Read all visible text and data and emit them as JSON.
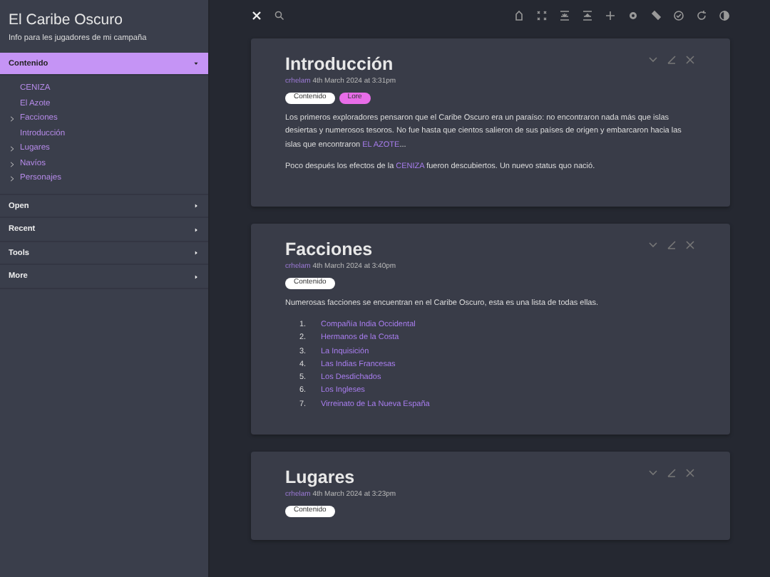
{
  "sidebar": {
    "title": "El Caribe Oscuro",
    "subtitle": "Info para les jugadores de mi campaña",
    "sections": [
      {
        "label": "Contenido",
        "expanded": true,
        "items": [
          {
            "label": "CENIZA",
            "kind": "leaf"
          },
          {
            "label": "El Azote",
            "kind": "leaf"
          },
          {
            "label": "Facciones",
            "kind": "folder"
          },
          {
            "label": "Introducción",
            "kind": "leaf"
          },
          {
            "label": "Lugares",
            "kind": "folder"
          },
          {
            "label": "Navíos",
            "kind": "folder"
          },
          {
            "label": "Personajes",
            "kind": "folder"
          }
        ]
      },
      {
        "label": "Open",
        "expanded": false
      },
      {
        "label": "Recent",
        "expanded": false
      },
      {
        "label": "Tools",
        "expanded": false
      },
      {
        "label": "More",
        "expanded": false
      }
    ]
  },
  "tiddlers": [
    {
      "title": "Introducción",
      "author": "crhelam",
      "date": "4th March 2024 at 3:31pm",
      "tags": [
        {
          "label": "Contenido",
          "color": "#ffffff"
        },
        {
          "label": "Lore",
          "color": "#e86de8"
        }
      ],
      "body": [
        {
          "kind": "paragraph",
          "parts": [
            {
              "kind": "text",
              "text": "Los primeros exploradores pensaron que el Caribe Oscuro era un paraíso: no encontraron nada más que islas desiertas y numerosos tesoros. No fue hasta que cientos salieron de sus países de origen y embarcaron hacia las islas que encontraron "
            },
            {
              "kind": "link",
              "text": "EL AZOTE"
            },
            {
              "kind": "text",
              "text": "..."
            }
          ]
        },
        {
          "kind": "paragraph",
          "parts": [
            {
              "kind": "text",
              "text": "Poco después los efectos de la "
            },
            {
              "kind": "link",
              "text": "CENIZA"
            },
            {
              "kind": "text",
              "text": " fueron descubiertos. Un nuevo status quo nació."
            }
          ]
        }
      ]
    },
    {
      "title": "Facciones",
      "author": "crhelam",
      "date": "4th March 2024 at 3:40pm",
      "tags": [
        {
          "label": "Contenido",
          "color": "#ffffff"
        }
      ],
      "body": [
        {
          "kind": "paragraph",
          "parts": [
            {
              "kind": "text",
              "text": "Numerosas facciones se encuentran en el Caribe Oscuro, esta es una lista de todas ellas."
            }
          ]
        },
        {
          "kind": "list",
          "items": [
            {
              "number": "1.",
              "text": "Compañía India Occidental"
            },
            {
              "number": "2.",
              "text": "Hermanos de la Costa"
            },
            {
              "number": "3.",
              "text": "La Inquisición"
            },
            {
              "number": "4.",
              "text": "Las Indias Francesas"
            },
            {
              "number": "5.",
              "text": "Los Desdichados"
            },
            {
              "number": "6.",
              "text": "Los Ingleses"
            },
            {
              "number": "7.",
              "text": "Virreinato de La Nueva España"
            }
          ]
        }
      ]
    },
    {
      "title": "Lugares",
      "author": "crhelam",
      "date": "4th March 2024 at 3:23pm",
      "tags": [
        {
          "label": "Contenido",
          "color": "#ffffff"
        }
      ]
    }
  ]
}
